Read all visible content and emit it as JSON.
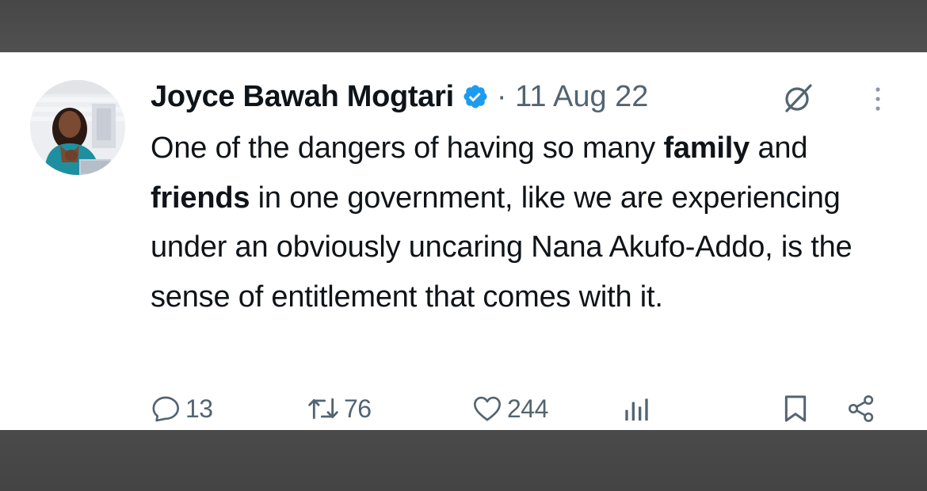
{
  "tweet": {
    "author_name": "Joyce Bawah Mogtari",
    "separator": "·",
    "date": "11 Aug 22",
    "text_parts": [
      {
        "text": "One of the dangers of having so many ",
        "bold": false
      },
      {
        "text": "family",
        "bold": true
      },
      {
        "text": " and ",
        "bold": false
      },
      {
        "text": "friends",
        "bold": true
      },
      {
        "text": " in one government, like we are experiencing under an obviously uncaring Nana Akufo-Addo, is the sense of entitlement that comes with it.",
        "bold": false
      }
    ]
  },
  "metrics": {
    "replies": "13",
    "reposts": "76",
    "likes": "244"
  },
  "colors": {
    "verified_badge": "#1d9bf0",
    "text": "#0f1419",
    "muted": "#536471",
    "frame": "#4c4c4c"
  },
  "icons": {
    "verified": "verified-badge-icon",
    "grok": "grok-icon",
    "more": "more-options-icon",
    "reply": "reply-icon",
    "repost": "repost-icon",
    "like": "heart-icon",
    "views": "views-chart-icon",
    "bookmark": "bookmark-icon",
    "share": "share-icon"
  }
}
